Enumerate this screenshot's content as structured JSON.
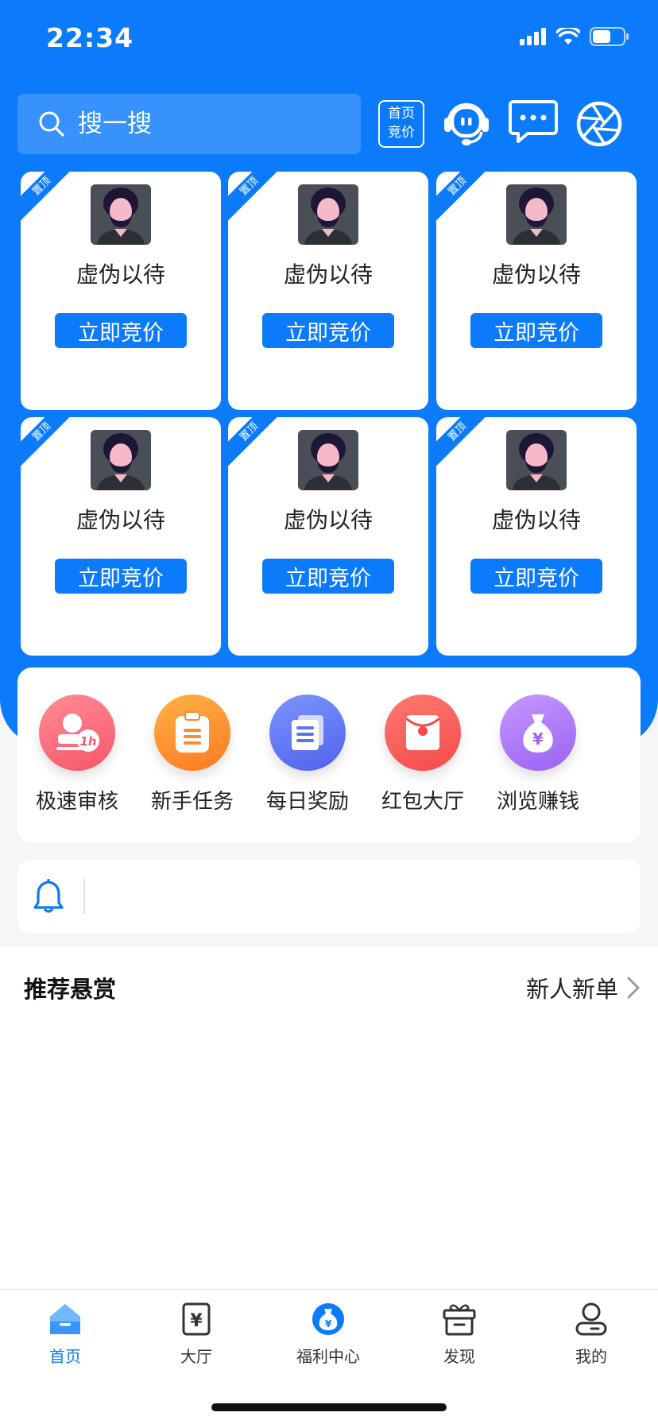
{
  "status_bar": {
    "time": "22:34"
  },
  "header": {
    "search_placeholder": "搜一搜",
    "bid_badge_line1": "首页",
    "bid_badge_line2": "竞价"
  },
  "cards": [
    {
      "ribbon": "置顶",
      "name": "虚伪以待",
      "button": "立即竞价"
    },
    {
      "ribbon": "置顶",
      "name": "虚伪以待",
      "button": "立即竞价"
    },
    {
      "ribbon": "置顶",
      "name": "虚伪以待",
      "button": "立即竞价"
    },
    {
      "ribbon": "置顶",
      "name": "虚伪以待",
      "button": "立即竞价"
    },
    {
      "ribbon": "置顶",
      "name": "虚伪以待",
      "button": "立即竞价"
    },
    {
      "ribbon": "置顶",
      "name": "虚伪以待",
      "button": "立即竞价"
    }
  ],
  "quick_menu": [
    {
      "label": "极速审核",
      "icon": "stamp-1h-icon",
      "color": "#fb6b7a"
    },
    {
      "label": "新手任务",
      "icon": "clipboard-icon",
      "color": "#fd8a2b"
    },
    {
      "label": "每日奖励",
      "icon": "documents-icon",
      "color": "#5a74f3"
    },
    {
      "label": "红包大厅",
      "icon": "red-envelope-icon",
      "color": "#fa5755"
    },
    {
      "label": "浏览赚钱",
      "icon": "money-bag-icon",
      "color": "#a978f5"
    }
  ],
  "reward_section": {
    "title": "推荐悬赏",
    "link": "新人新单"
  },
  "tabbar": [
    {
      "label": "首页",
      "icon": "home-icon",
      "active": true
    },
    {
      "label": "大厅",
      "icon": "yuan-tablet-icon",
      "active": false
    },
    {
      "label": "福利中心",
      "icon": "money-bag-icon",
      "active": false
    },
    {
      "label": "发现",
      "icon": "gift-box-icon",
      "active": false
    },
    {
      "label": "我的",
      "icon": "user-icon",
      "active": false
    }
  ],
  "colors": {
    "primary": "#0b7bfb",
    "background": "#f5f6f7"
  }
}
